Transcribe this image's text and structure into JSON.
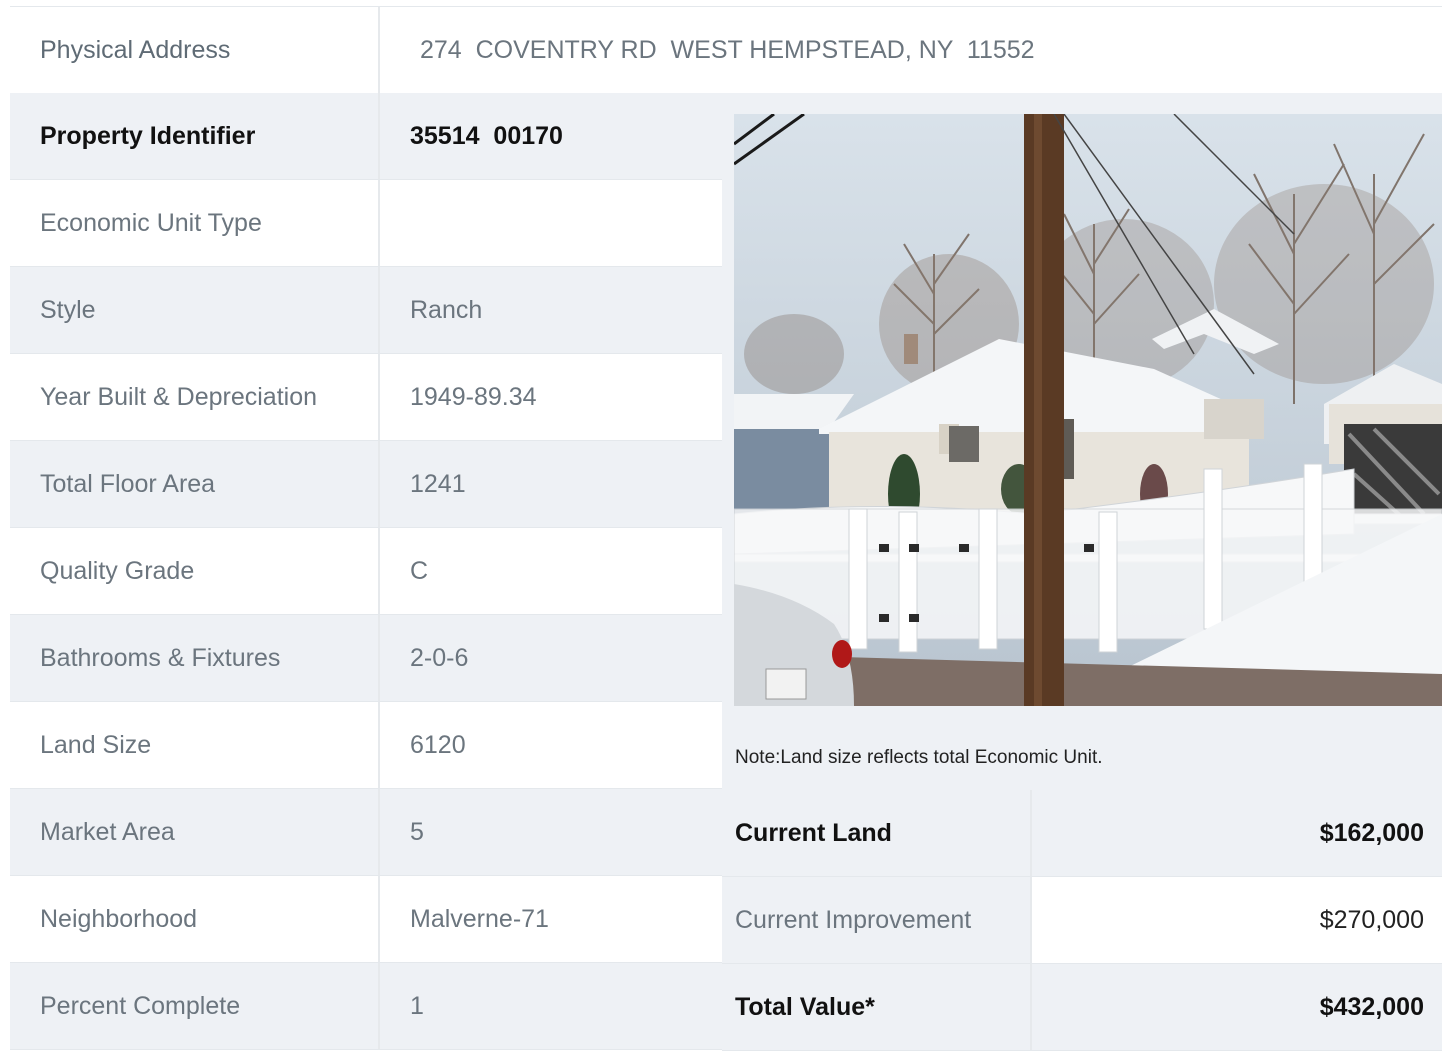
{
  "address": {
    "label": "Physical Address",
    "value": "274  COVENTRY RD  WEST HEMPSTEAD, NY  11552"
  },
  "details": [
    {
      "label": "Property Identifier",
      "value": "35514  00170",
      "bold": true
    },
    {
      "label": "Economic Unit Type",
      "value": ""
    },
    {
      "label": "Style",
      "value": "Ranch"
    },
    {
      "label": "Year Built & Depreciation",
      "value": "1949-89.34"
    },
    {
      "label": "Total Floor Area",
      "value": "1241"
    },
    {
      "label": "Quality Grade",
      "value": "C"
    },
    {
      "label": "Bathrooms & Fixtures",
      "value": "2-0-6"
    },
    {
      "label": "Land Size",
      "value": "6120"
    },
    {
      "label": "Market Area",
      "value": "5"
    },
    {
      "label": "Neighborhood",
      "value": "Malverne-71"
    },
    {
      "label": "Percent Complete",
      "value": "1"
    }
  ],
  "note": "Note:Land size reflects total Economic Unit.",
  "values": [
    {
      "label": "Current Land",
      "value": "$162,000",
      "bold": true
    },
    {
      "label": "Current Improvement",
      "value": "$270,000",
      "bold": false
    },
    {
      "label": "Total Value*",
      "value": "$432,000",
      "bold": true
    }
  ],
  "colors": {
    "row_shade": "#eef1f5",
    "border": "#e4e8ec",
    "text_muted": "#6b757e",
    "text_strong": "#111111"
  }
}
